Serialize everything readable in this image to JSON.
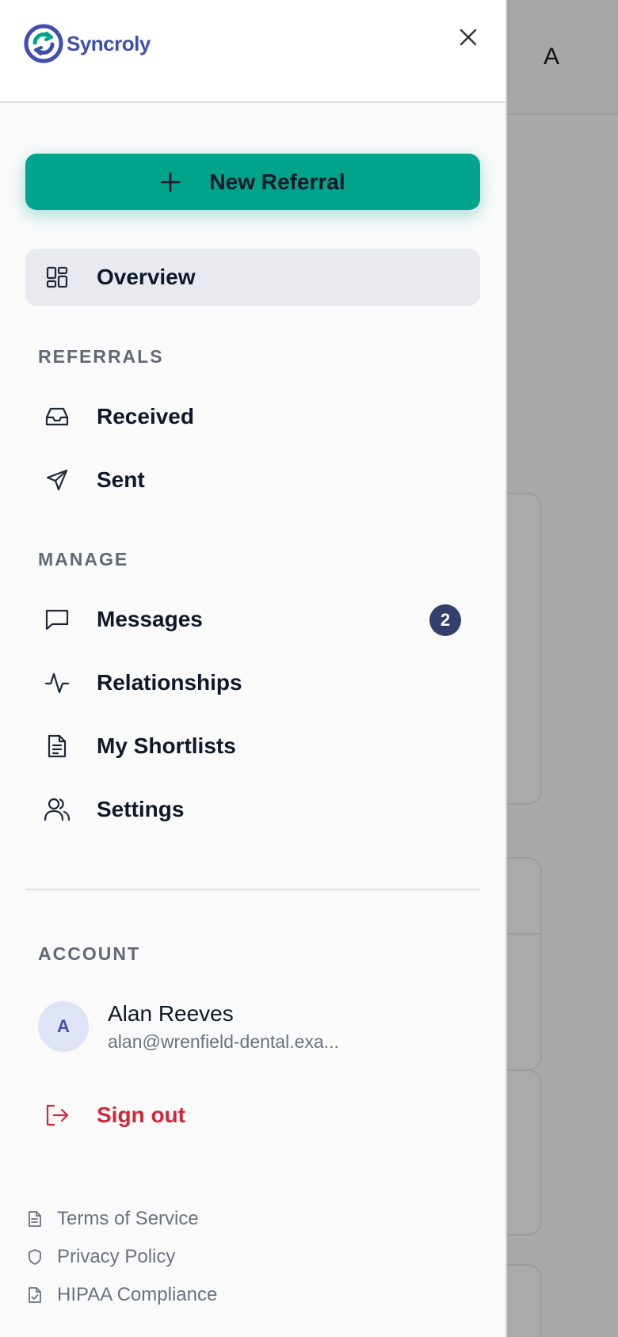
{
  "brand": {
    "name": "Syncroly",
    "color": "#3f4fb0",
    "accent": "#00a38b"
  },
  "header": {
    "close_icon": "close-icon"
  },
  "primary_action": {
    "label": "New Referral",
    "icon": "plus-icon"
  },
  "nav": {
    "overview": {
      "label": "Overview",
      "icon": "grid-icon"
    },
    "referrals_title": "REFERRALS",
    "received": {
      "label": "Received",
      "icon": "inbox-icon"
    },
    "sent": {
      "label": "Sent",
      "icon": "send-icon"
    },
    "manage_title": "MANAGE",
    "messages": {
      "label": "Messages",
      "icon": "message-icon",
      "badge": "2"
    },
    "relationships": {
      "label": "Relationships",
      "icon": "activity-icon"
    },
    "shortlists": {
      "label": "My Shortlists",
      "icon": "document-icon"
    },
    "settings": {
      "label": "Settings",
      "icon": "users-icon"
    }
  },
  "account": {
    "title": "ACCOUNT",
    "initial": "A",
    "name": "Alan Reeves",
    "email": "alan@wrenfield-dental.exa..."
  },
  "signout": {
    "label": "Sign out",
    "icon": "logout-icon",
    "color": "#d32636"
  },
  "footer": {
    "terms": "Terms of Service",
    "privacy": "Privacy Policy",
    "hipaa": "HIPAA Compliance"
  },
  "background": {
    "avatar_letter": "A"
  }
}
